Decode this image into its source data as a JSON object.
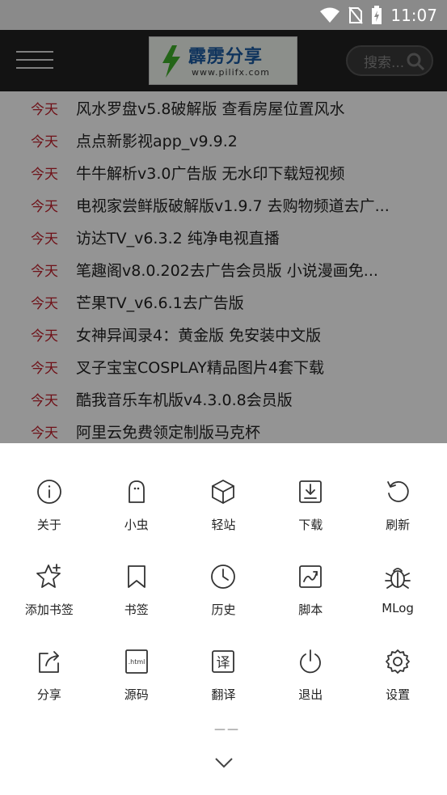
{
  "status_bar": {
    "time": "11:07"
  },
  "header": {
    "logo_text": "霹雳分享",
    "logo_url": "www.pilifx.com",
    "search_placeholder": "搜索..."
  },
  "list": {
    "items": [
      {
        "tag": "今天",
        "title": "风水罗盘v5.8破解版 查看房屋位置风水"
      },
      {
        "tag": "今天",
        "title": "点点新影视app_v9.9.2"
      },
      {
        "tag": "今天",
        "title": "牛牛解析v3.0广告版 无水印下载短视频"
      },
      {
        "tag": "今天",
        "title": "电视家尝鲜版破解版v1.9.7 去购物频道去广..."
      },
      {
        "tag": "今天",
        "title": "访达TV_v6.3.2 纯净电视直播"
      },
      {
        "tag": "今天",
        "title": "笔趣阁v8.0.202去广告会员版 小说漫画免..."
      },
      {
        "tag": "今天",
        "title": "芒果TV_v6.6.1去广告版"
      },
      {
        "tag": "今天",
        "title": "女神异闻录4：黄金版 免安装中文版"
      },
      {
        "tag": "今天",
        "title": "叉子宝宝COSPLAY精品图片4套下载"
      },
      {
        "tag": "今天",
        "title": "酷我音乐车机版v4.3.0.8会员版"
      },
      {
        "tag": "今天",
        "title": "阿里云免费领定制版马克杯"
      }
    ]
  },
  "sheet": {
    "items": [
      {
        "label": "关于",
        "icon": "info-icon"
      },
      {
        "label": "小虫",
        "icon": "ghost-icon"
      },
      {
        "label": "轻站",
        "icon": "cube-icon"
      },
      {
        "label": "下载",
        "icon": "download-icon"
      },
      {
        "label": "刷新",
        "icon": "refresh-icon"
      },
      {
        "label": "添加书签",
        "icon": "star-plus-icon"
      },
      {
        "label": "书签",
        "icon": "bookmark-icon"
      },
      {
        "label": "历史",
        "icon": "clock-icon"
      },
      {
        "label": "脚本",
        "icon": "script-icon"
      },
      {
        "label": "MLog",
        "icon": "bug-icon"
      },
      {
        "label": "分享",
        "icon": "share-icon"
      },
      {
        "label": "源码",
        "icon": "html-source-icon"
      },
      {
        "label": "翻译",
        "icon": "translate-icon"
      },
      {
        "label": "退出",
        "icon": "power-icon"
      },
      {
        "label": "设置",
        "icon": "gear-icon"
      }
    ],
    "more_indicator": "——",
    "icon_html_text": ".html",
    "icon_translate_text": "译"
  }
}
